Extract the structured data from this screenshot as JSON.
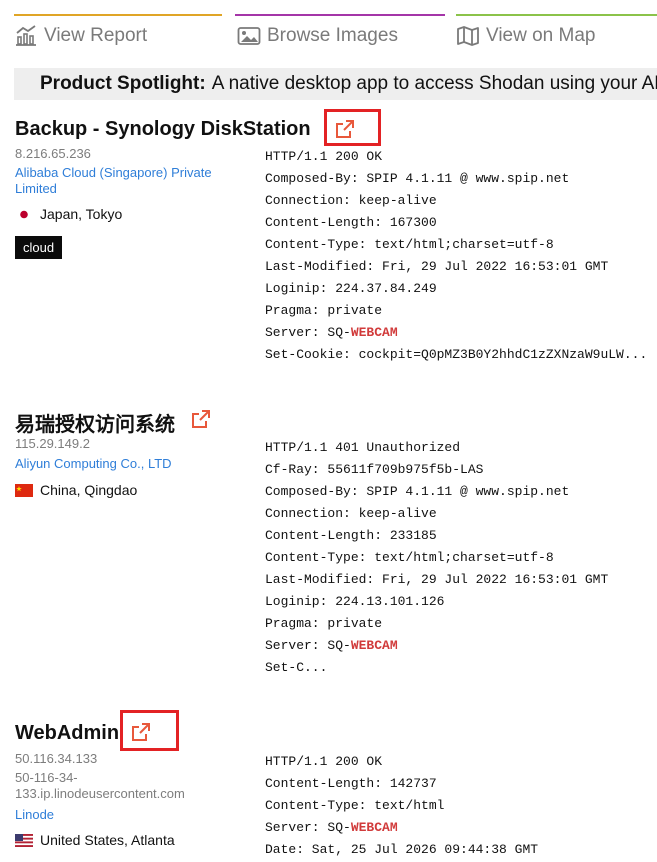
{
  "tabs": [
    {
      "label": "View Report",
      "icon": "chart-icon",
      "color": "#e0a526"
    },
    {
      "label": "Browse Images",
      "icon": "image-icon",
      "color": "#a435a8"
    },
    {
      "label": "View on Map",
      "icon": "map-icon",
      "color": "#8bc34a"
    }
  ],
  "spotlight": {
    "bold": "Product Spotlight:",
    "text": "A native desktop app to access Shodan using your AP"
  },
  "results": [
    {
      "title": "Backup - Synology DiskStation",
      "ip": "8.216.65.236",
      "org": "Alibaba Cloud (Singapore) Private Limited",
      "location": "Japan, Tokyo",
      "flag": "japan-flag",
      "tag": "cloud",
      "banner": [
        "HTTP/1.1 200 OK",
        "Composed-By: SPIP 4.1.11 @ www.spip.net",
        "Connection: keep-alive",
        "Content-Length: 167300",
        "Content-Type: text/html;charset=utf-8",
        "Last-Modified: Fri, 29 Jul 2022 16:53:01 GMT",
        "Loginip: 224.37.84.249",
        "Pragma: private",
        "Server: SQ-|WEBCAM",
        "Set-Cookie: cockpit=Q0pMZ3B0Y2hhdC1zZXNzaW9uLW..."
      ]
    },
    {
      "title": "易瑞授权访问系统",
      "ip": "115.29.149.2",
      "org": "Aliyun Computing Co., LTD",
      "location": "China, Qingdao",
      "flag": "china-flag",
      "banner": [
        "HTTP/1.1 401 Unauthorized",
        "Cf-Ray: 55611f709b975f5b-LAS",
        "Composed-By: SPIP 4.1.11 @ www.spip.net",
        "Connection: keep-alive",
        "Content-Length: 233185",
        "Content-Type: text/html;charset=utf-8",
        "Last-Modified: Fri, 29 Jul 2022 16:53:01 GMT",
        "Loginip: 224.13.101.126",
        "Pragma: private",
        "Server: SQ-|WEBCAM",
        "Set-C..."
      ]
    },
    {
      "title": "WebAdmin",
      "ip": "50.116.34.133",
      "hostname": "50-116-34-133.ip.linodeusercontent.com",
      "org": "Linode",
      "location": "United States, Atlanta",
      "flag": "usa-flag",
      "banner": [
        "HTTP/1.1 200 OK",
        "Content-Length: 142737",
        "Content-Type: text/html",
        "Server: SQ-|WEBCAM",
        "Date: Sat, 25 Jul 2026 09:44:38 GMT"
      ]
    }
  ],
  "colors": {
    "link": "#2f7ed8",
    "highlight_box": "#e32224",
    "external_icon": "#e8583b",
    "keyword": "#d13b3b"
  }
}
